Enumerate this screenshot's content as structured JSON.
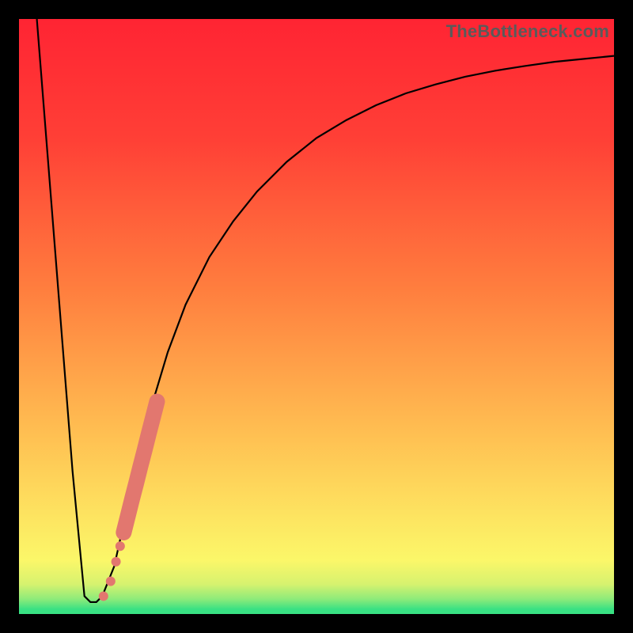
{
  "watermark": "TheBottleneck.com",
  "chart_data": {
    "type": "line",
    "title": "",
    "xlabel": "",
    "ylabel": "",
    "xlim": [
      0,
      100
    ],
    "ylim": [
      0,
      100
    ],
    "series": [
      {
        "name": "main-curve",
        "x": [
          3,
          6,
          9,
          11,
          12,
          13,
          14,
          16,
          18,
          20,
          22,
          25,
          28,
          32,
          36,
          40,
          45,
          50,
          55,
          60,
          65,
          70,
          75,
          80,
          85,
          90,
          95,
          100
        ],
        "values": [
          100,
          62,
          24,
          3,
          2,
          2,
          3,
          8,
          17,
          26,
          34,
          44,
          52,
          60,
          66,
          71,
          76,
          80,
          83,
          85.5,
          87.5,
          89,
          90.3,
          91.3,
          92.1,
          92.8,
          93.3,
          93.8
        ]
      }
    ],
    "scatter": {
      "name": "highlight-points",
      "color": "#e2776f",
      "points": [
        {
          "x": 14.2,
          "y": 3.0,
          "r": 6
        },
        {
          "x": 15.4,
          "y": 5.5,
          "r": 6
        },
        {
          "x": 16.3,
          "y": 8.8,
          "r": 6
        },
        {
          "x": 17.0,
          "y": 11.4,
          "r": 6
        },
        {
          "x": 17.6,
          "y": 13.7,
          "r": 10
        },
        {
          "x": 18.3,
          "y": 16.5,
          "r": 10
        },
        {
          "x": 19.0,
          "y": 19.3,
          "r": 10
        },
        {
          "x": 19.7,
          "y": 22.0,
          "r": 10
        },
        {
          "x": 20.4,
          "y": 24.8,
          "r": 10
        },
        {
          "x": 21.1,
          "y": 27.5,
          "r": 10
        },
        {
          "x": 21.8,
          "y": 30.3,
          "r": 10
        },
        {
          "x": 22.5,
          "y": 33.0,
          "r": 10
        },
        {
          "x": 23.2,
          "y": 35.7,
          "r": 10
        }
      ]
    },
    "gradient_bands": [
      {
        "y": 0.0,
        "color": "#39e183"
      },
      {
        "y": 0.8,
        "color": "#39e183"
      },
      {
        "y": 2.5,
        "color": "#8deb7a"
      },
      {
        "y": 5.0,
        "color": "#d6f26f"
      },
      {
        "y": 9.0,
        "color": "#fbf769"
      },
      {
        "y": 16.0,
        "color": "#fde561"
      },
      {
        "y": 30.0,
        "color": "#ffc052"
      },
      {
        "y": 55.0,
        "color": "#ff7d3e"
      },
      {
        "y": 80.0,
        "color": "#ff3f36"
      },
      {
        "y": 100.0,
        "color": "#ff2433"
      }
    ]
  }
}
